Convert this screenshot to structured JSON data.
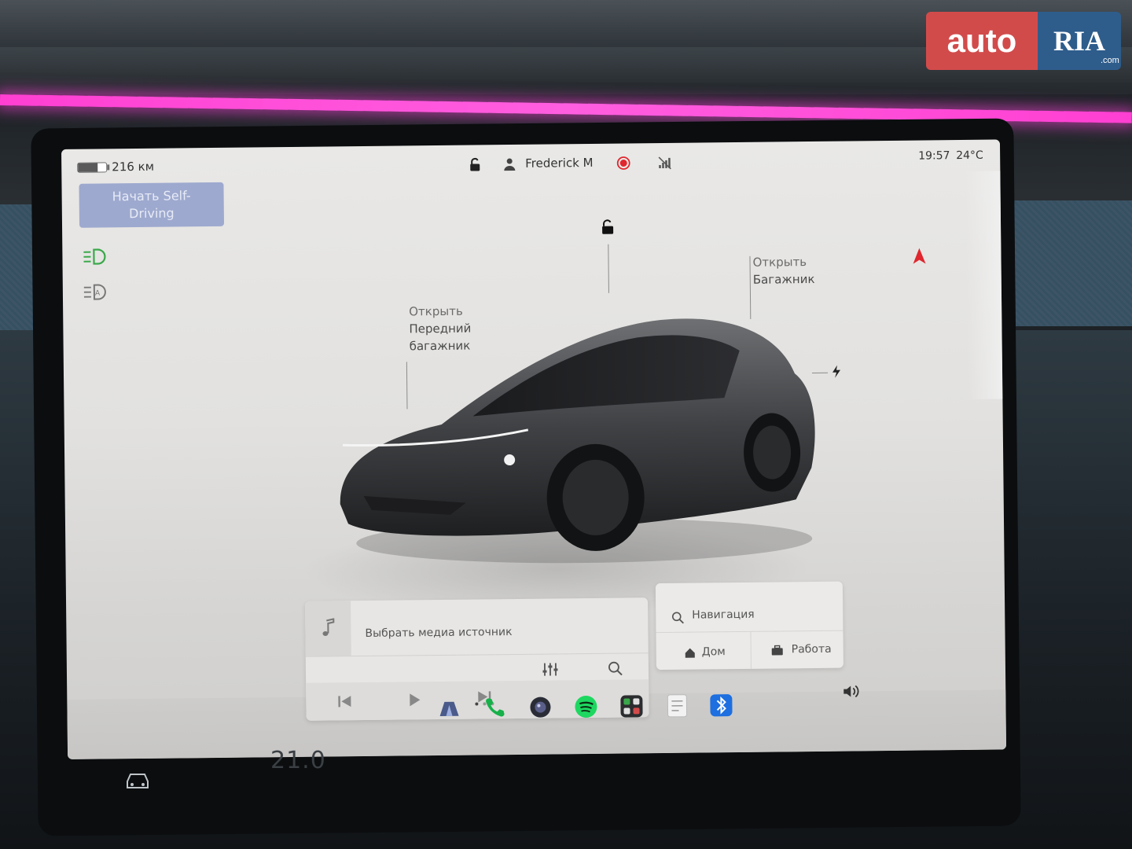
{
  "status_bar": {
    "range": "216 км",
    "battery_level": 0.7,
    "driver_name": "Frederick M",
    "time": "19:57",
    "temperature": "24°C"
  },
  "self_driving": {
    "label_line1": "Начать Self-",
    "label_line2": "Driving"
  },
  "car_controls": {
    "frunk_line1": "Открыть",
    "frunk_line2": "Передний",
    "frunk_line3": "багажник",
    "trunk_line1": "Открыть",
    "trunk_line2": "Багажник"
  },
  "media": {
    "source_prompt": "Выбрать медиа источник"
  },
  "navigation": {
    "search_label": "Навигация",
    "home_label": "Дом",
    "work_label": "Работа"
  },
  "climate": {
    "cabin_temp": "21.0"
  },
  "watermark": {
    "auto": "auto",
    "ria": "RIA",
    "com": ".com"
  },
  "colors": {
    "accent_blue": "#9ea9cf",
    "record_red": "#e0262e",
    "headlight_green": "#3aa84a",
    "nav_arrow_red": "#e0262e",
    "ambient_pink": "#ff4fd8"
  },
  "icons": [
    "lock-icon",
    "driver-icon",
    "record-icon",
    "no-signal-icon",
    "headlight-icon",
    "auto-headlight-icon",
    "charge-port-icon",
    "nav-arrow-icon",
    "music-note-icon",
    "equalizer-icon",
    "search-icon",
    "prev-icon",
    "play-icon",
    "next-icon",
    "home-icon",
    "briefcase-icon",
    "volume-icon",
    "car-icon",
    "camera-icon",
    "phone-icon",
    "spotify-icon",
    "apps-icon",
    "notes-icon",
    "bluetooth-icon"
  ]
}
